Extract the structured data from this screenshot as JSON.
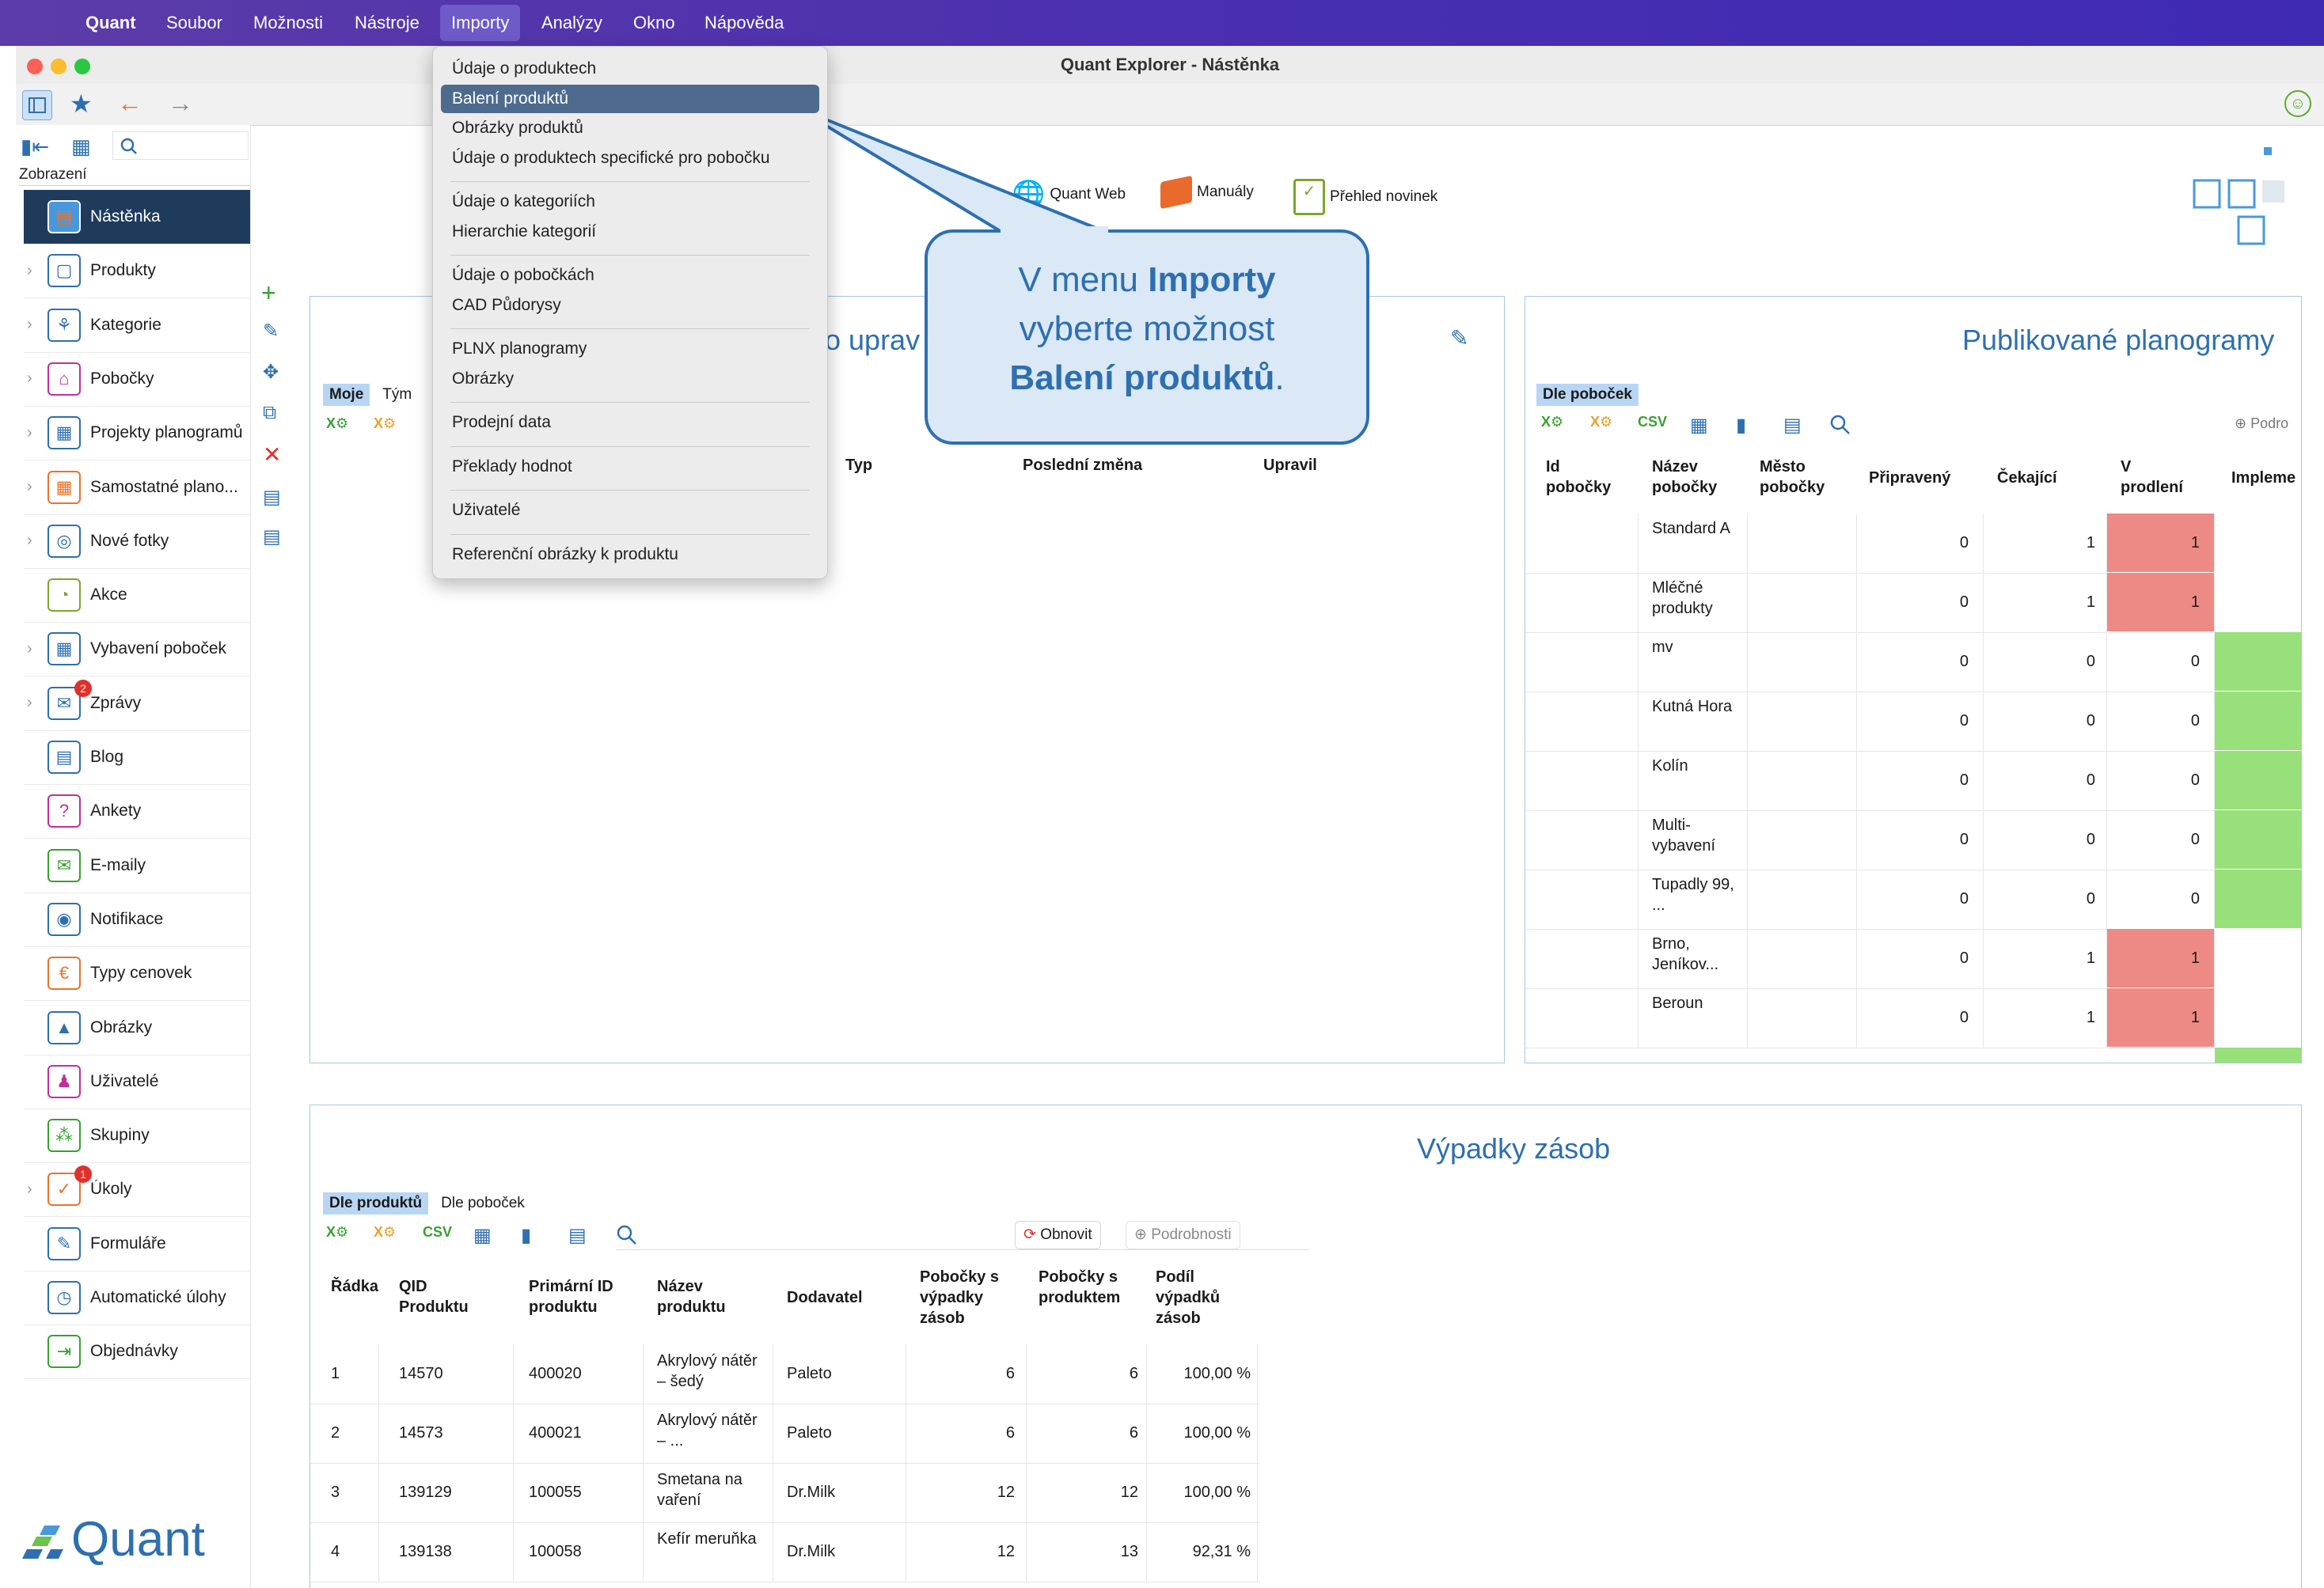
{
  "menubar": {
    "app": "Quant",
    "items": [
      "Soubor",
      "Možnosti",
      "Nástroje",
      "Importy",
      "Analýzy",
      "Okno",
      "Nápověda"
    ]
  },
  "window": {
    "title": "Quant Explorer - Nástěnka"
  },
  "sidebar": {
    "section_label": "Zobrazení",
    "items": [
      {
        "label": "Nástěnka"
      },
      {
        "label": "Produkty"
      },
      {
        "label": "Kategorie"
      },
      {
        "label": "Pobočky"
      },
      {
        "label": "Projekty planogramů"
      },
      {
        "label": "Samostatné plano..."
      },
      {
        "label": "Nové fotky"
      },
      {
        "label": "Akce"
      },
      {
        "label": "Vybavení poboček"
      },
      {
        "label": "Zprávy",
        "badge": "2"
      },
      {
        "label": "Blog"
      },
      {
        "label": "Ankety"
      },
      {
        "label": "E-maily"
      },
      {
        "label": "Notifikace"
      },
      {
        "label": "Typy cenovek"
      },
      {
        "label": "Obrázky"
      },
      {
        "label": "Uživatelé"
      },
      {
        "label": "Skupiny"
      },
      {
        "label": "Úkoly",
        "badge": "1"
      },
      {
        "label": "Formuláře"
      },
      {
        "label": "Automatické úlohy"
      },
      {
        "label": "Objednávky"
      }
    ],
    "logo_text": "Quant"
  },
  "links": {
    "web": "Quant Web",
    "manuals": "Manuály",
    "news": "Přehled novinek"
  },
  "dropdown": {
    "items": [
      "Údaje o produktech",
      "Balení produktů",
      "Obrázky produktů",
      "Údaje o produktech specifické pro pobočku",
      "Údaje o kategoriích",
      "Hierarchie kategorií",
      "Údaje o pobočkách",
      "CAD Půdorysy",
      "PLNX planogramy",
      "Obrázky",
      "Prodejní data",
      "Překlady hodnot",
      "Uživatelé",
      "Referenční obrázky k produktu"
    ],
    "selected": "Balení produktů"
  },
  "callout": {
    "line1_pre": "V menu ",
    "line1_bold": "Importy",
    "line2": "vyberte možnost",
    "line3_bold": "Balení produktů",
    "line3_post": "."
  },
  "left_panel": {
    "title_fragment": "o uprav",
    "tabs": [
      "Moje",
      "Tým"
    ],
    "columns": [
      "Typ",
      "Poslední změna",
      "Upravil"
    ]
  },
  "planograms": {
    "title": "Publikované planogramy",
    "tab": "Dle poboček",
    "detail_button": "Podro",
    "columns": [
      "Id pobočky",
      "Název pobočky",
      "Město pobočky",
      "Připravený",
      "Čekající",
      "V prodlení",
      "Impleme"
    ],
    "rows": [
      {
        "name": "Standard A",
        "ready": "0",
        "waiting": "1",
        "delay": "1",
        "status": "red"
      },
      {
        "name": "Mléčné produkty",
        "ready": "0",
        "waiting": "1",
        "delay": "1",
        "status": "red"
      },
      {
        "name": "mv",
        "ready": "0",
        "waiting": "0",
        "delay": "0",
        "status": "green"
      },
      {
        "name": "Kutná Hora",
        "ready": "0",
        "waiting": "0",
        "delay": "0",
        "status": "green"
      },
      {
        "name": "Kolín",
        "ready": "0",
        "waiting": "0",
        "delay": "0",
        "status": "green"
      },
      {
        "name": "Multi-vybavení",
        "ready": "0",
        "waiting": "0",
        "delay": "0",
        "status": "green"
      },
      {
        "name": "Tupadly 99, ...",
        "ready": "0",
        "waiting": "0",
        "delay": "0",
        "status": "green"
      },
      {
        "name": "Brno, Jeníkov...",
        "ready": "0",
        "waiting": "1",
        "delay": "1",
        "status": "red"
      },
      {
        "name": "Beroun",
        "ready": "0",
        "waiting": "1",
        "delay": "1",
        "status": "red"
      }
    ]
  },
  "stockouts": {
    "title": "Výpadky zásob",
    "tabs": [
      "Dle produktů",
      "Dle poboček"
    ],
    "refresh_label": "Obnovit",
    "details_label": "Podrobnosti",
    "columns": [
      "Řádka",
      "QID Produktu",
      "Primární ID produktu",
      "Název produktu",
      "Dodavatel",
      "Pobočky s výpadky zásob",
      "Pobočky s produktem",
      "Podíl výpadků zásob"
    ],
    "rows": [
      {
        "row": "1",
        "qid": "14570",
        "pid": "400020",
        "name": "Akrylový nátěr – šedý",
        "supplier": "Paleto",
        "out": "6",
        "with": "6",
        "share": "100,00 %"
      },
      {
        "row": "2",
        "qid": "14573",
        "pid": "400021",
        "name": "Akrylový nátěr – ...",
        "supplier": "Paleto",
        "out": "6",
        "with": "6",
        "share": "100,00 %"
      },
      {
        "row": "3",
        "qid": "139129",
        "pid": "100055",
        "name": "Smetana na vaření",
        "supplier": "Dr.Milk",
        "out": "12",
        "with": "12",
        "share": "100,00 %"
      },
      {
        "row": "4",
        "qid": "139138",
        "pid": "100058",
        "name": "Kefír meruňka",
        "supplier": "Dr.Milk",
        "out": "12",
        "with": "13",
        "share": "92,31 %"
      }
    ]
  },
  "colors": {
    "accent": "#2e6fb0",
    "red": "#ee8a86",
    "green": "#98e07a",
    "sidebar_active": "#1f3b5c"
  }
}
